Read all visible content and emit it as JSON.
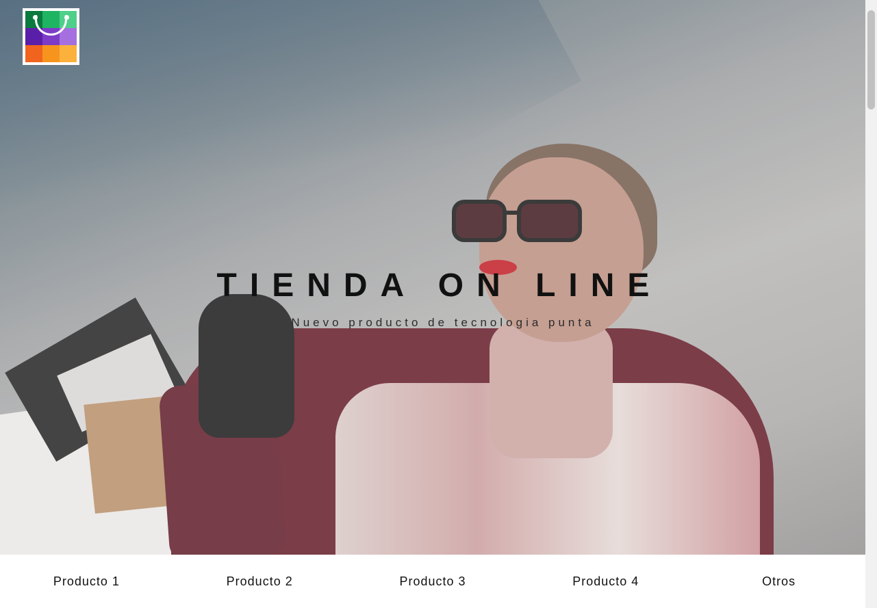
{
  "hero": {
    "title": "TIENDA ON LINE",
    "subtitle": "Nuevo producto de tecnologia punta"
  },
  "logo": {
    "icon": "shopping-bag-icon",
    "colors": [
      "#0b7a3e",
      "#1fb462",
      "#4fcf8a",
      "#5a1fa8",
      "#7d3cc8",
      "#a66fe0",
      "#f0641e",
      "#f7941d",
      "#fbb13c"
    ]
  },
  "nav": {
    "items": [
      "Producto 1",
      "Producto 2",
      "Producto 3",
      "Producto 4",
      "Otros"
    ]
  }
}
